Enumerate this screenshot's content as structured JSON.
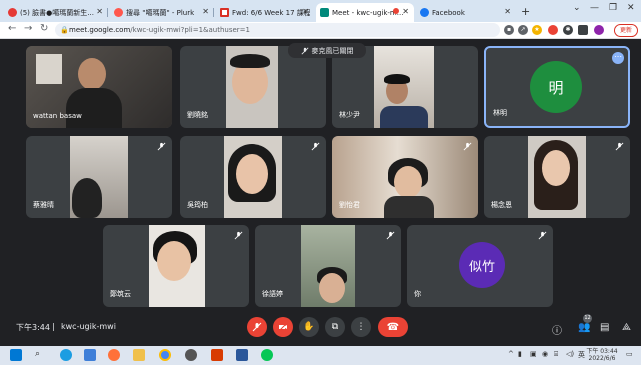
{
  "browser": {
    "tabs": [
      {
        "title": "(5) 臉書●噶瑪蘭新生..."
      },
      {
        "title": "搜尋 \"噶瑪蘭\" - Plurk"
      },
      {
        "title": "Fwd: 6/6 Week 17 課程..."
      },
      {
        "title": "Meet - kwc-ugik-m..."
      },
      {
        "title": "Facebook"
      }
    ],
    "url_host": "meet.google.com",
    "url_path": "/kwc-ugik-mwi?pli=1&authuser=1",
    "update_label": "更新"
  },
  "meet": {
    "toast": "麥克風已關閉",
    "participants": [
      {
        "name": "wattan basaw",
        "muted": false
      },
      {
        "name": "劉曉銘",
        "muted": false
      },
      {
        "name": "林少尹",
        "muted": false
      },
      {
        "name": "林明",
        "muted": false,
        "avatar_letter": "明",
        "avatar_color": "#1e8e3e"
      },
      {
        "name": "蔡雅晴",
        "muted": true
      },
      {
        "name": "吳筠柏",
        "muted": true
      },
      {
        "name": "劉怡君",
        "muted": true
      },
      {
        "name": "楊念恩",
        "muted": true
      },
      {
        "name": "鄭筑云",
        "muted": true
      },
      {
        "name": "徐語婷",
        "muted": true
      },
      {
        "name": "你",
        "muted": true,
        "avatar_letter": "似竹",
        "avatar_color": "#5b2bb5"
      }
    ],
    "time": "下午3:44",
    "separator": "|",
    "meeting_code": "kwc-ugik-mwi",
    "people_count": "12"
  },
  "taskbar": {
    "clock_time": "下午 03:44",
    "clock_date": "2022/6/6"
  },
  "colors": {
    "meet_bg": "#202124",
    "tile_bg": "#3c4043",
    "leave_red": "#ea4335",
    "active_tile_border": "#8ab4f8"
  }
}
